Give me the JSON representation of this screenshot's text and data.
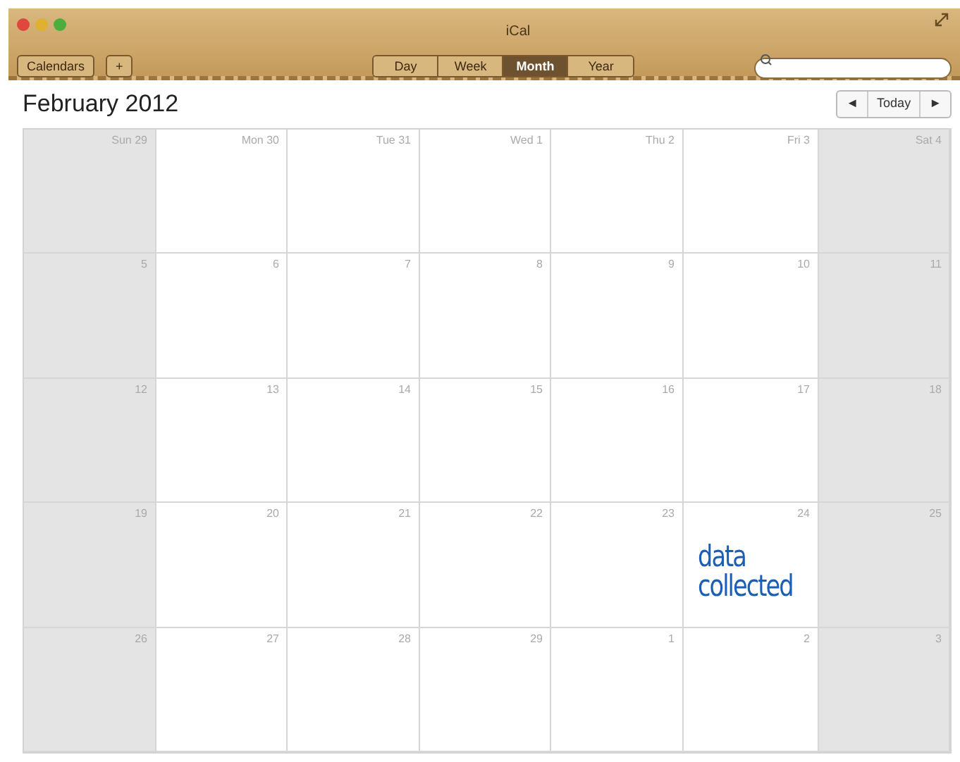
{
  "window": {
    "title": "iCal"
  },
  "toolbar": {
    "calendars_button": "Calendars",
    "add_button": "+",
    "views": [
      {
        "label": "Day",
        "selected": false
      },
      {
        "label": "Week",
        "selected": false
      },
      {
        "label": "Month",
        "selected": true
      },
      {
        "label": "Year",
        "selected": false
      }
    ]
  },
  "header": {
    "title": "February 2012",
    "prev": "◄",
    "today": "Today",
    "next": "►"
  },
  "weeks": [
    [
      {
        "label": "Sun 29",
        "weekend": true
      },
      {
        "label": "Mon 30",
        "weekend": false
      },
      {
        "label": "Tue 31",
        "weekend": false
      },
      {
        "label": "Wed 1",
        "weekend": false
      },
      {
        "label": "Thu 2",
        "weekend": false
      },
      {
        "label": "Fri 3",
        "weekend": false
      },
      {
        "label": "Sat 4",
        "weekend": true
      }
    ],
    [
      {
        "label": "5",
        "weekend": true
      },
      {
        "label": "6",
        "weekend": false
      },
      {
        "label": "7",
        "weekend": false
      },
      {
        "label": "8",
        "weekend": false
      },
      {
        "label": "9",
        "weekend": false
      },
      {
        "label": "10",
        "weekend": false
      },
      {
        "label": "11",
        "weekend": true
      }
    ],
    [
      {
        "label": "12",
        "weekend": true
      },
      {
        "label": "13",
        "weekend": false
      },
      {
        "label": "14",
        "weekend": false
      },
      {
        "label": "15",
        "weekend": false
      },
      {
        "label": "16",
        "weekend": false
      },
      {
        "label": "17",
        "weekend": false
      },
      {
        "label": "18",
        "weekend": true
      }
    ],
    [
      {
        "label": "19",
        "weekend": true
      },
      {
        "label": "20",
        "weekend": false
      },
      {
        "label": "21",
        "weekend": false
      },
      {
        "label": "22",
        "weekend": false
      },
      {
        "label": "23",
        "weekend": false
      },
      {
        "label": "24",
        "weekend": false,
        "event": {
          "text": "data collected",
          "color": "#1a5fb4"
        }
      },
      {
        "label": "25",
        "weekend": true
      }
    ],
    [
      {
        "label": "26",
        "weekend": true
      },
      {
        "label": "27",
        "weekend": false
      },
      {
        "label": "28",
        "weekend": false
      },
      {
        "label": "29",
        "weekend": false
      },
      {
        "label": "1",
        "weekend": false
      },
      {
        "label": "2",
        "weekend": false
      },
      {
        "label": "3",
        "weekend": true
      }
    ]
  ]
}
